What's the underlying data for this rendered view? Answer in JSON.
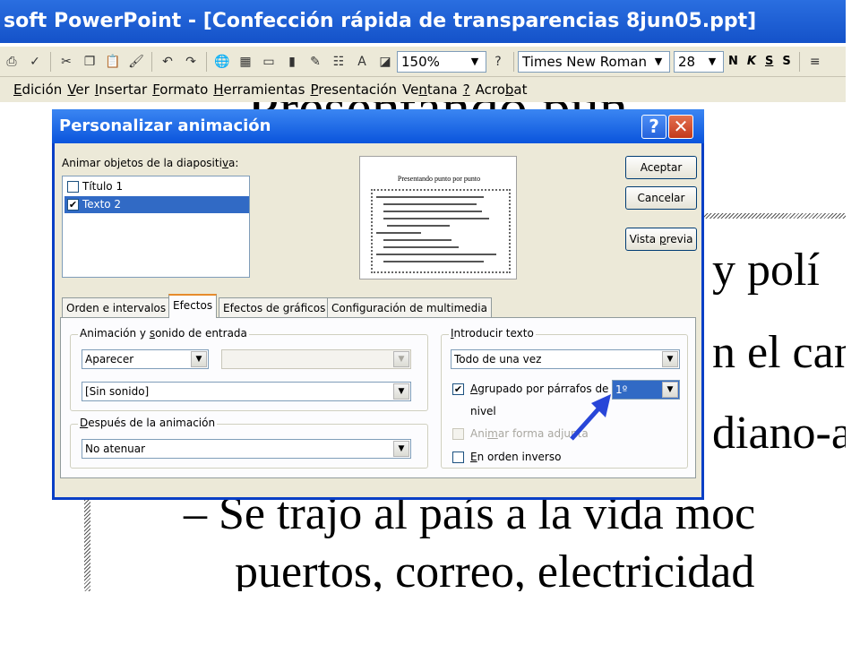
{
  "app": {
    "title": "soft PowerPoint - [Confección rápida de transparencias 8jun05.ppt]"
  },
  "toolbar": {
    "zoom": "150%",
    "font": "Times New Roman",
    "font_size": "28",
    "bold": "N",
    "italic": "K",
    "underline": "S",
    "shadow": "S"
  },
  "menu": [
    {
      "pre": "",
      "acc": "E",
      "post": "dición"
    },
    {
      "pre": "",
      "acc": "V",
      "post": "er"
    },
    {
      "pre": "",
      "acc": "I",
      "post": "nsertar"
    },
    {
      "pre": "",
      "acc": "F",
      "post": "ormato"
    },
    {
      "pre": "",
      "acc": "H",
      "post": "erramientas"
    },
    {
      "pre": "",
      "acc": "P",
      "post": "resentación"
    },
    {
      "pre": "Ve",
      "acc": "n",
      "post": "tana"
    },
    {
      "pre": "",
      "acc": "?",
      "post": ""
    },
    {
      "pre": "Acro",
      "acc": "b",
      "post": "at"
    }
  ],
  "slide": {
    "title_fragment": "Presentando pun",
    "lines": [
      "y polí",
      "n el can",
      "diano-al",
      "–   Se trajo al país a la vida moc",
      "puertos, correo, electricidad"
    ]
  },
  "dialog": {
    "title": "Personalizar animación",
    "objects_label_pre": "Animar objetos de la diapositi",
    "objects_label_acc": "v",
    "objects_label_post": "a:",
    "objects": [
      {
        "label": "Título 1",
        "checked": false,
        "selected": false
      },
      {
        "label": "Texto 2",
        "checked": true,
        "selected": true
      }
    ],
    "preview_title": "Presentando punto por punto",
    "buttons": {
      "accept": "Aceptar",
      "cancel": "Cancelar",
      "preview_pre": "Vista ",
      "preview_acc": "p",
      "preview_post": "revia"
    },
    "tabs": [
      {
        "label": "Orden e intervalos",
        "active": false
      },
      {
        "label": "Efectos",
        "active": true
      },
      {
        "label": "Efectos de gráficos",
        "active": false
      },
      {
        "label": "Configuración de multimedia",
        "active": false
      }
    ],
    "entry_group": {
      "title_pre": "Animación y ",
      "title_acc": "s",
      "title_post": "onido de entrada",
      "effect": "Aparecer",
      "effect_direction": "",
      "sound": "[Sin sonido]"
    },
    "after_group": {
      "title_pre": "",
      "title_acc": "D",
      "title_post": "espués de la animación",
      "value": "No atenuar"
    },
    "text_group": {
      "title_pre": "",
      "title_acc": "I",
      "title_post": "ntroducir texto",
      "mode": "Todo de una vez",
      "group_pre": "",
      "group_acc": "A",
      "group_post": "grupado por párrafos de",
      "group_checked": true,
      "level_value": "1º",
      "level_label": "nivel",
      "attached_pre": "Ani",
      "attached_acc": "m",
      "attached_post": "ar forma adjunta",
      "reverse_pre": "",
      "reverse_acc": "E",
      "reverse_post": "n orden inverso",
      "reverse_checked": false
    }
  },
  "colors": {
    "titlebar": "#1452c9",
    "selection": "#316ac5",
    "arrow": "#2846d8"
  }
}
